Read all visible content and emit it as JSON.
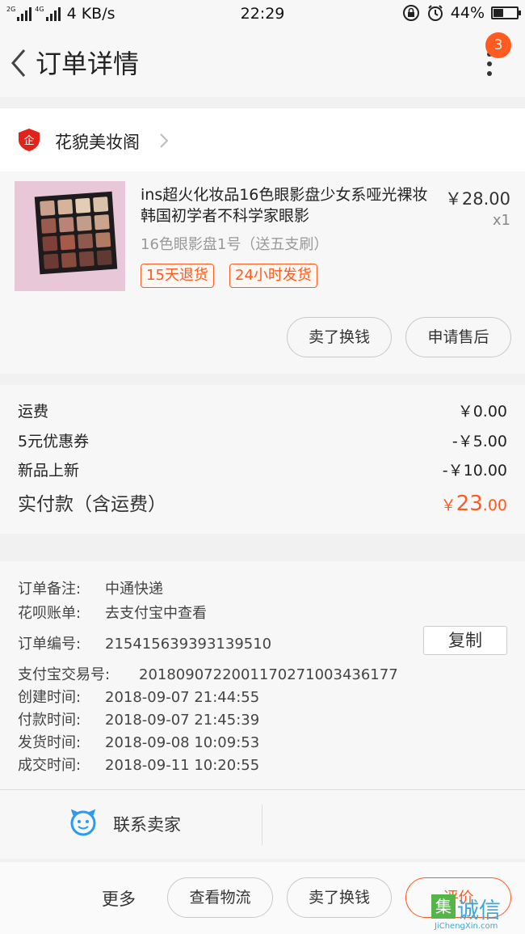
{
  "status_bar": {
    "net1": "2G",
    "net2": "4G",
    "speed": "4 KB/s",
    "time": "22:29",
    "battery": "44%",
    "battery_level": 0.44
  },
  "nav": {
    "title": "订单详情",
    "badge_count": "3"
  },
  "shop": {
    "logo_text": "企",
    "name": "花貌美妆阁"
  },
  "item": {
    "title": "ins超火化妆品16色眼影盘少女系哑光裸妆韩国初学者不科学家眼影",
    "price": "￥28.00",
    "qty": "x1",
    "sku": "16色眼影盘1号（送五支刷）",
    "tags": [
      "15天退货",
      "24小时发货"
    ],
    "actions": [
      "卖了换钱",
      "申请售后"
    ]
  },
  "fees": {
    "shipping_label": "运费",
    "shipping_value": "￥0.00",
    "coupon_label": "5元优惠券",
    "coupon_value": "-￥5.00",
    "promo_label": "新品上新",
    "promo_value": "-￥10.00",
    "total_label": "实付款（含运费）",
    "total_currency": "￥",
    "total_int": "23",
    "total_dec": ".00"
  },
  "info": {
    "remark_label": "订单备注:",
    "remark_value": "中通快递",
    "huabei_label": "花呗账单:",
    "huabei_value": "去支付宝中查看",
    "order_no_label": "订单编号:",
    "order_no_value": "215415639393139510",
    "copy_label": "复制",
    "alipay_label": "支付宝交易号:",
    "alipay_value": "2018090722001170271003436177",
    "created_label": "创建时间:",
    "created_value": "2018-09-07 21:44:55",
    "paid_label": "付款时间:",
    "paid_value": "2018-09-07 21:45:39",
    "shipped_label": "发货时间:",
    "shipped_value": "2018-09-08 10:09:53",
    "done_label": "成交时间:",
    "done_value": "2018-09-11 10:20:55"
  },
  "contact": {
    "label": "联系卖家"
  },
  "bottom_bar": {
    "more": "更多",
    "logistics": "查看物流",
    "resell": "卖了换钱",
    "rate": "评价"
  },
  "watermark": {
    "box": "集",
    "text": "诚信",
    "sub": "JiChengXin.com"
  },
  "colors": {
    "accent": "#ff5a1f",
    "background": "#f1f1f1",
    "card": "#f7f7f7"
  },
  "icons": [
    "back-arrow-icon",
    "more-dots-icon",
    "shop-logo-icon",
    "chevron-right-icon",
    "chat-face-icon"
  ]
}
